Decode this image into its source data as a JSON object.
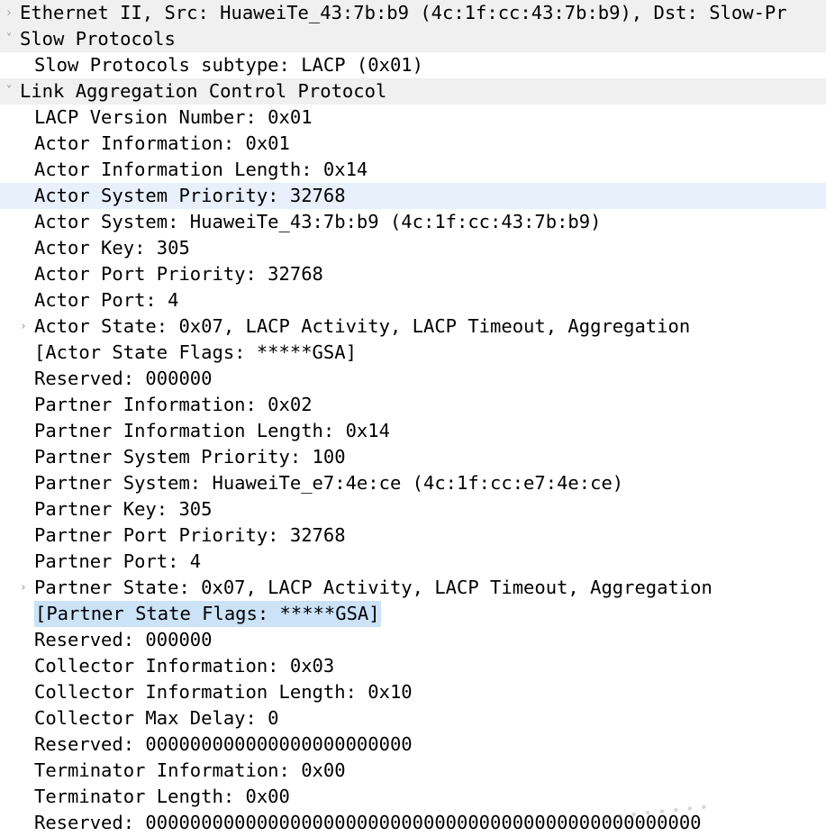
{
  "pane": {
    "name": "packet-details-tree",
    "colors": {
      "background": "#ffffff",
      "section_row": "#f0f0f0",
      "highlight_row": "#e7f0fb",
      "selection": "#cbe2f7",
      "text": "#000000",
      "twisty": "#9a9a9a"
    },
    "chevron_expanded": "˅",
    "chevron_collapsed": "›"
  },
  "rows": [
    {
      "text": "Ethernet II, Src: HuaweiTe_43:7b:b9 (4c:1f:cc:43:7b:b9), Dst: Slow-Pr",
      "kind": "section",
      "expandable": true,
      "expanded": false,
      "background": "gray",
      "truncated": true,
      "name": "row-ethernet-ii"
    },
    {
      "text": "Slow Protocols",
      "kind": "section",
      "expandable": true,
      "expanded": true,
      "background": "gray",
      "name": "row-slow-protocols"
    },
    {
      "text": "Slow Protocols subtype: LACP (0x01)",
      "kind": "leaf",
      "expandable": false,
      "background": "plain",
      "name": "row-slow-protocols-subtype"
    },
    {
      "text": "Link Aggregation Control Protocol",
      "kind": "section",
      "expandable": true,
      "expanded": true,
      "background": "gray",
      "name": "row-link-aggregation-control-protocol"
    },
    {
      "text": "LACP Version Number: 0x01",
      "kind": "leaf",
      "expandable": false,
      "background": "plain",
      "name": "row-lacp-version-number"
    },
    {
      "text": "Actor Information: 0x01",
      "kind": "leaf",
      "expandable": false,
      "background": "plain",
      "name": "row-actor-information"
    },
    {
      "text": "Actor Information Length: 0x14",
      "kind": "leaf",
      "expandable": false,
      "background": "plain",
      "name": "row-actor-information-length"
    },
    {
      "text": "Actor System Priority: 32768",
      "kind": "leaf",
      "expandable": false,
      "background": "highlight",
      "name": "row-actor-system-priority"
    },
    {
      "text": "Actor System: HuaweiTe_43:7b:b9 (4c:1f:cc:43:7b:b9)",
      "kind": "leaf",
      "expandable": false,
      "background": "plain",
      "name": "row-actor-system"
    },
    {
      "text": "Actor Key: 305",
      "kind": "leaf",
      "expandable": false,
      "background": "plain",
      "name": "row-actor-key"
    },
    {
      "text": "Actor Port Priority: 32768",
      "kind": "leaf",
      "expandable": false,
      "background": "plain",
      "name": "row-actor-port-priority"
    },
    {
      "text": "Actor Port: 4",
      "kind": "leaf",
      "expandable": false,
      "background": "plain",
      "name": "row-actor-port"
    },
    {
      "text": "Actor State: 0x07, LACP Activity, LACP Timeout, Aggregation",
      "kind": "leaf",
      "expandable": true,
      "expanded": false,
      "background": "plain",
      "name": "row-actor-state"
    },
    {
      "text": "[Actor State Flags: *****GSA]",
      "kind": "leaf",
      "expandable": false,
      "background": "plain",
      "name": "row-actor-state-flags"
    },
    {
      "text": "Reserved: 000000",
      "kind": "leaf",
      "expandable": false,
      "background": "plain",
      "name": "row-actor-reserved"
    },
    {
      "text": "Partner Information: 0x02",
      "kind": "leaf",
      "expandable": false,
      "background": "plain",
      "name": "row-partner-information"
    },
    {
      "text": "Partner Information Length: 0x14",
      "kind": "leaf",
      "expandable": false,
      "background": "plain",
      "name": "row-partner-information-length"
    },
    {
      "text": "Partner System Priority: 100",
      "kind": "leaf",
      "expandable": false,
      "background": "plain",
      "name": "row-partner-system-priority"
    },
    {
      "text": "Partner System: HuaweiTe_e7:4e:ce (4c:1f:cc:e7:4e:ce)",
      "kind": "leaf",
      "expandable": false,
      "background": "plain",
      "name": "row-partner-system"
    },
    {
      "text": "Partner Key: 305",
      "kind": "leaf",
      "expandable": false,
      "background": "plain",
      "name": "row-partner-key"
    },
    {
      "text": "Partner Port Priority: 32768",
      "kind": "leaf",
      "expandable": false,
      "background": "plain",
      "name": "row-partner-port-priority"
    },
    {
      "text": "Partner Port: 4",
      "kind": "leaf",
      "expandable": false,
      "background": "plain",
      "name": "row-partner-port"
    },
    {
      "text": "Partner State: 0x07, LACP Activity, LACP Timeout, Aggregation",
      "kind": "leaf",
      "expandable": true,
      "expanded": false,
      "background": "plain",
      "name": "row-partner-state"
    },
    {
      "text": "[Partner State Flags: *****GSA]",
      "kind": "leaf",
      "expandable": false,
      "background": "plain",
      "selected": true,
      "name": "row-partner-state-flags"
    },
    {
      "text": "Reserved: 000000",
      "kind": "leaf",
      "expandable": false,
      "background": "plain",
      "name": "row-partner-reserved"
    },
    {
      "text": "Collector Information: 0x03",
      "kind": "leaf",
      "expandable": false,
      "background": "plain",
      "name": "row-collector-information"
    },
    {
      "text": "Collector Information Length: 0x10",
      "kind": "leaf",
      "expandable": false,
      "background": "plain",
      "name": "row-collector-information-length"
    },
    {
      "text": "Collector Max Delay: 0",
      "kind": "leaf",
      "expandable": false,
      "background": "plain",
      "name": "row-collector-max-delay"
    },
    {
      "text": "Reserved: 000000000000000000000000",
      "kind": "leaf",
      "expandable": false,
      "background": "plain",
      "name": "row-collector-reserved"
    },
    {
      "text": "Terminator Information: 0x00",
      "kind": "leaf",
      "expandable": false,
      "background": "plain",
      "name": "row-terminator-information"
    },
    {
      "text": "Terminator Length: 0x00",
      "kind": "leaf",
      "expandable": false,
      "background": "plain",
      "name": "row-terminator-length"
    },
    {
      "text": "Reserved: 00000000000000000000000000000000000000000000000000",
      "kind": "leaf",
      "expandable": false,
      "background": "plain",
      "name": "row-terminator-reserved"
    }
  ],
  "watermark": {
    "text": "• • • • • • • •"
  }
}
